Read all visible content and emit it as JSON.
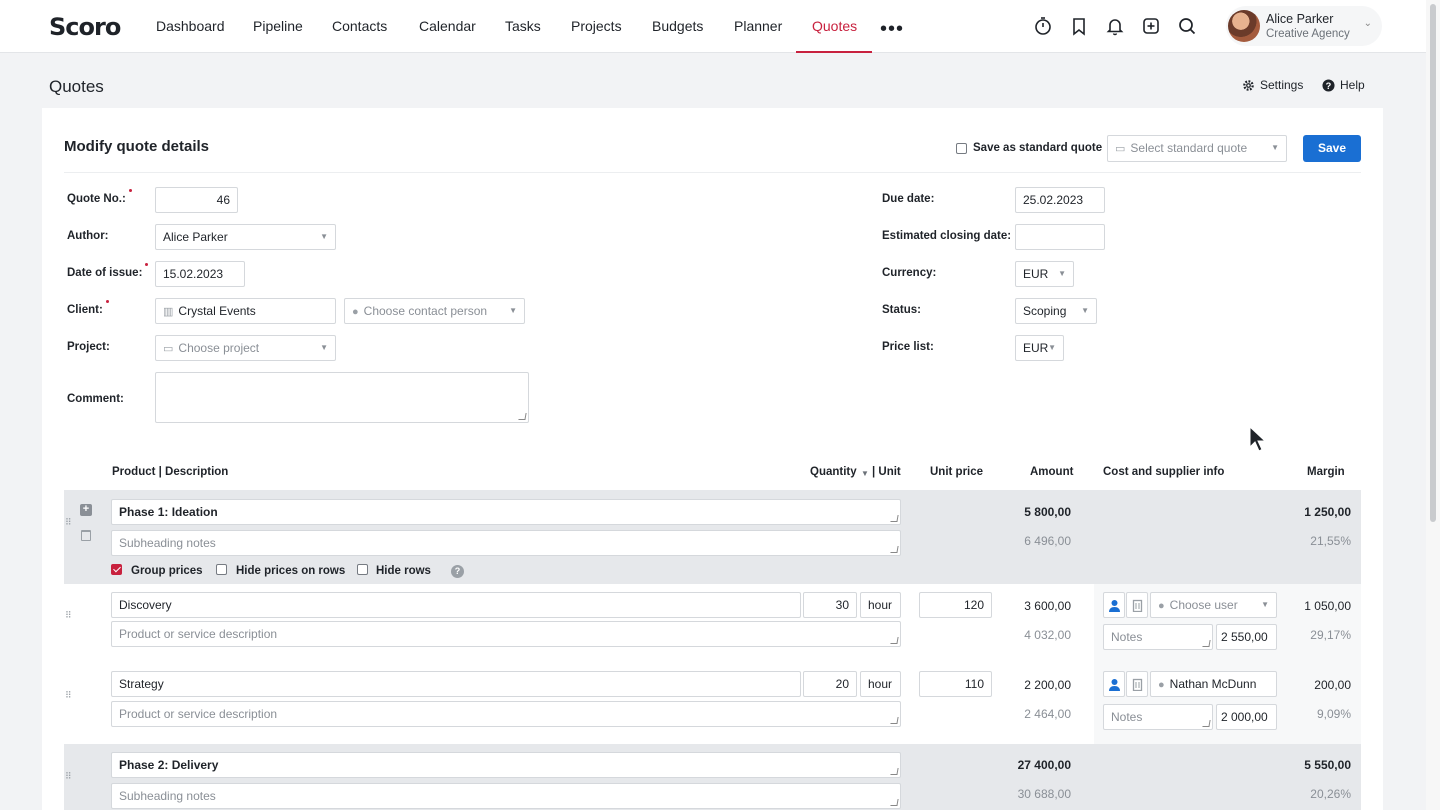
{
  "app": {
    "logo": "Scoro"
  },
  "nav": {
    "items": [
      {
        "label": "Dashboard"
      },
      {
        "label": "Pipeline"
      },
      {
        "label": "Contacts"
      },
      {
        "label": "Calendar"
      },
      {
        "label": "Tasks"
      },
      {
        "label": "Projects"
      },
      {
        "label": "Budgets"
      },
      {
        "label": "Planner"
      },
      {
        "label": "Quotes"
      }
    ],
    "active": "Quotes",
    "more": "•••"
  },
  "user": {
    "name": "Alice Parker",
    "org": "Creative Agency"
  },
  "page": {
    "title": "Quotes",
    "settings": "Settings",
    "help": "Help"
  },
  "card": {
    "title": "Modify quote details",
    "save_standard_label": "Save as standard quote",
    "select_standard_placeholder": "Select standard quote",
    "save_label": "Save"
  },
  "form": {
    "quote_no": {
      "label": "Quote No.:",
      "value": "46"
    },
    "author": {
      "label": "Author:",
      "value": "Alice Parker"
    },
    "date_of_issue": {
      "label": "Date of issue:",
      "value": "15.02.2023"
    },
    "client": {
      "label": "Client:",
      "value": "Crystal Events",
      "contact_placeholder": "Choose contact person"
    },
    "project": {
      "label": "Project:",
      "placeholder": "Choose project"
    },
    "comment": {
      "label": "Comment:",
      "value": ""
    },
    "due_date": {
      "label": "Due date:",
      "value": "25.02.2023"
    },
    "closing_date": {
      "label": "Estimated closing date:",
      "value": ""
    },
    "currency": {
      "label": "Currency:",
      "value": "EUR"
    },
    "status": {
      "label": "Status:",
      "value": "Scoping"
    },
    "price_list": {
      "label": "Price list:",
      "value": "EUR"
    }
  },
  "table": {
    "headers": {
      "product": "Product | Description",
      "quantity": "Quantity",
      "unit": "| Unit",
      "unit_price": "Unit price",
      "amount": "Amount",
      "cost": "Cost and supplier info",
      "margin": "Margin"
    },
    "phase1": {
      "title": "Phase 1: Ideation",
      "notes_placeholder": "Subheading notes",
      "amount": "5 800,00",
      "amount_vat": "6 496,00",
      "margin": "1 250,00",
      "margin_pct": "21,55%",
      "group_prices": "Group prices",
      "hide_prices": "Hide prices on rows",
      "hide_rows": "Hide rows",
      "help": "?"
    },
    "rows": [
      {
        "name": "Discovery",
        "desc_placeholder": "Product or service description",
        "qty": "30",
        "unit": "hour",
        "unit_price": "120",
        "amount": "3 600,00",
        "amount_vat": "4 032,00",
        "user_placeholder": "Choose user",
        "user": "",
        "notes_placeholder": "Notes",
        "cost": "2 550,00",
        "margin": "1 050,00",
        "margin_pct": "29,17%"
      },
      {
        "name": "Strategy",
        "desc_placeholder": "Product or service description",
        "qty": "20",
        "unit": "hour",
        "unit_price": "110",
        "amount": "2 200,00",
        "amount_vat": "2 464,00",
        "user_placeholder": "",
        "user": "Nathan McDunn",
        "notes_placeholder": "Notes",
        "cost": "2 000,00",
        "margin": "200,00",
        "margin_pct": "9,09%"
      }
    ],
    "phase2": {
      "title": "Phase 2: Delivery",
      "notes_placeholder": "Subheading notes",
      "amount": "27 400,00",
      "amount_vat": "30 688,00",
      "margin": "5 550,00",
      "margin_pct": "20,26%"
    }
  },
  "colors": {
    "accent": "#c8213e",
    "primary_button": "#1a6fd3",
    "phase_bg": "#e6e8eb"
  }
}
